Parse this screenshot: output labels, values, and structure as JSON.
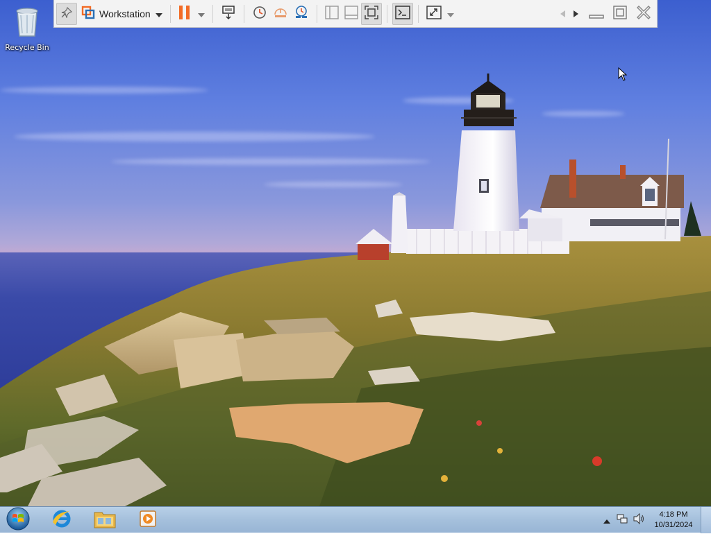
{
  "desktop": {
    "icons": [
      {
        "label": "Recycle Bin",
        "icon": "recycle-bin-icon"
      }
    ]
  },
  "vmware_toolbar": {
    "vm_name": "Workstation",
    "colors": {
      "accent_orange": "#f26b25",
      "icon_blue": "#2a6fb5"
    },
    "buttons": [
      {
        "icon": "pin-icon",
        "state": "pressed"
      },
      {
        "icon": "vmware-logo-icon"
      },
      {
        "icon": "dropdown-icon"
      },
      {
        "icon": "pause-icon"
      },
      {
        "icon": "dropdown-icon"
      },
      {
        "icon": "send-ctrl-alt-del-icon"
      },
      {
        "icon": "snapshot-icon"
      },
      {
        "icon": "revert-snapshot-icon"
      },
      {
        "icon": "snapshot-manager-icon"
      },
      {
        "icon": "sidebar-view-icon"
      },
      {
        "icon": "thumbnail-bar-icon"
      },
      {
        "icon": "fit-guest-icon",
        "state": "pressed"
      },
      {
        "icon": "console-view-icon",
        "state": "pressed"
      },
      {
        "icon": "full-screen-icon"
      },
      {
        "icon": "dropdown-icon"
      },
      {
        "icon": "nav-left-icon"
      },
      {
        "icon": "nav-right-icon"
      },
      {
        "icon": "minimize-icon"
      },
      {
        "icon": "restore-icon"
      },
      {
        "icon": "close-icon"
      }
    ]
  },
  "taskbar": {
    "start_icon": "windows-start-orb-icon",
    "pinned": [
      {
        "icon": "internet-explorer-icon"
      },
      {
        "icon": "windows-explorer-icon"
      },
      {
        "icon": "media-player-icon"
      }
    ],
    "tray": {
      "icons": [
        "show-hidden-icons-icon",
        "network-icon",
        "volume-icon"
      ],
      "time": "4:18 PM",
      "date": "10/31/2024"
    }
  }
}
